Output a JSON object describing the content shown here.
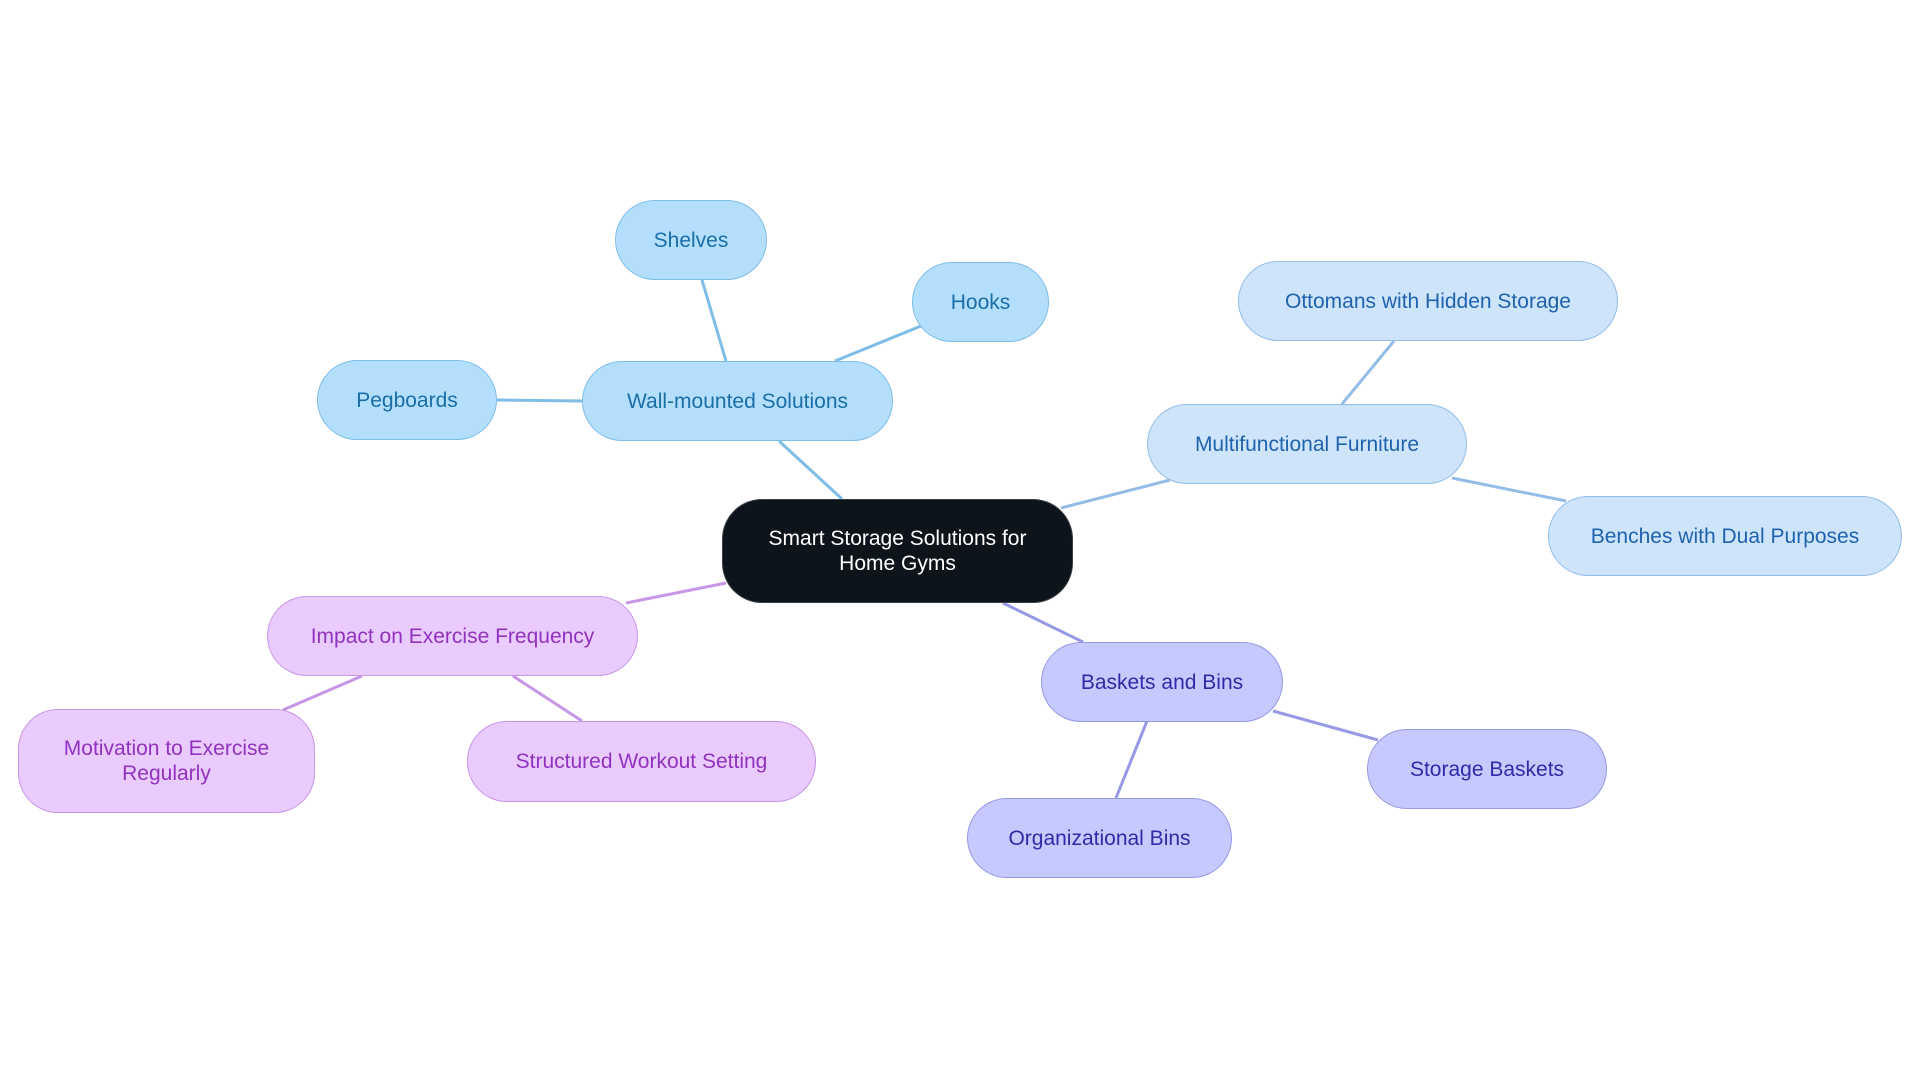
{
  "diagram": {
    "type": "mindmap",
    "root": {
      "id": "root",
      "label": "Smart Storage Solutions for Home Gyms",
      "label_lines": [
        "Smart Storage Solutions for",
        "Home Gyms"
      ]
    },
    "branches": [
      {
        "id": "wall",
        "label": "Wall-mounted Solutions",
        "color": "#b3dffc",
        "line_color": "#7fbde6",
        "children": [
          {
            "id": "shelves",
            "label": "Shelves"
          },
          {
            "id": "hooks",
            "label": "Hooks"
          },
          {
            "id": "pegboards",
            "label": "Pegboards"
          }
        ]
      },
      {
        "id": "multi",
        "label": "Multifunctional Furniture",
        "color": "#cde4fb",
        "line_color": "#93bde6",
        "children": [
          {
            "id": "ottomans",
            "label": "Ottomans with Hidden Storage"
          },
          {
            "id": "benches",
            "label": "Benches with Dual Purposes"
          }
        ]
      },
      {
        "id": "baskets",
        "label": "Baskets and Bins",
        "color": "#c6c9fd",
        "line_color": "#9699e5",
        "children": [
          {
            "id": "storage",
            "label": "Storage Baskets"
          },
          {
            "id": "orgbins",
            "label": "Organizational Bins"
          }
        ]
      },
      {
        "id": "impact",
        "label": "Impact on Exercise Frequency",
        "color": "#e9cbfd",
        "line_color": "#c796e6",
        "children": [
          {
            "id": "motivation",
            "label": "Motivation to Exercise Regularly",
            "label_lines": [
              "Motivation to Exercise",
              "Regularly"
            ]
          },
          {
            "id": "structured",
            "label": "Structured Workout Setting"
          }
        ]
      }
    ]
  }
}
